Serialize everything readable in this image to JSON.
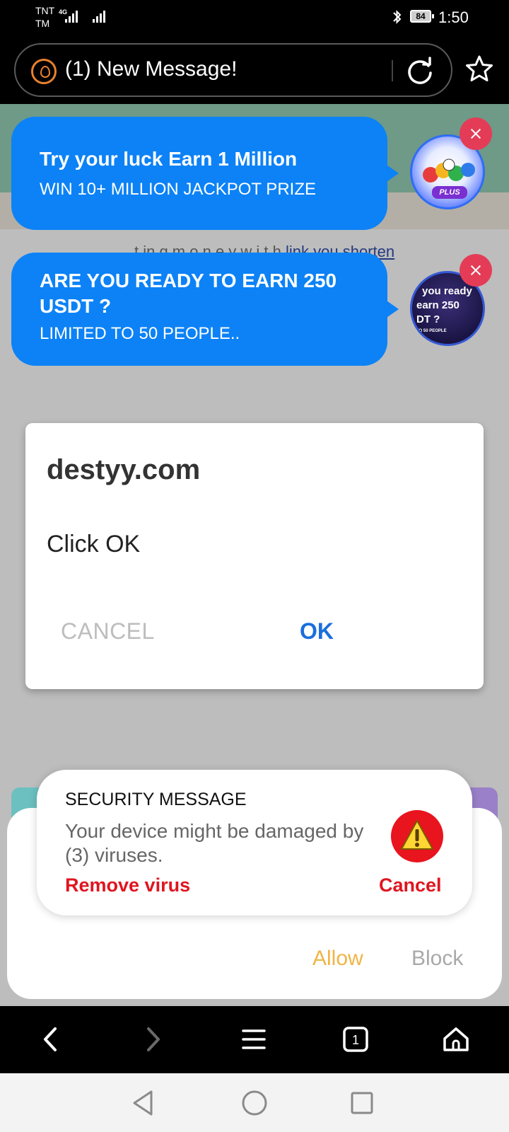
{
  "status_bar": {
    "carrier_line1": "TNT",
    "carrier_line2": "TM",
    "network_type": "4G",
    "battery_level": "84",
    "time": "1:50"
  },
  "address_bar": {
    "title": "(1) New Message!"
  },
  "page": {
    "text_fragment": "t in g  m  o  n  e  y  w  i  t  h",
    "link_text": "link you shorten"
  },
  "chat_heads": [
    {
      "title": "Try your luck Earn 1 Million",
      "subtitle": "WIN 10+ MILLION JACKPOT PRIZE",
      "avatar_label": "PLUS"
    },
    {
      "title": "ARE YOU READY TO EARN 250 USDT ?",
      "subtitle": "LIMITED TO 50 PEOPLE..",
      "avatar_line1": "you ready",
      "avatar_line2": "earn 250",
      "avatar_line3": "DT ?",
      "avatar_line4": "TO 50 PEOPLE"
    }
  ],
  "dialog": {
    "title": "destyy.com",
    "message": "Click OK",
    "cancel_label": "CANCEL",
    "ok_label": "OK"
  },
  "security_toast": {
    "title": "SECURITY MESSAGE",
    "body": "Your device might be damaged by (3) viruses.",
    "remove_label": "Remove virus",
    "cancel_label": "Cancel"
  },
  "permission": {
    "allow_label": "Allow",
    "block_label": "Block"
  },
  "browser_nav": {
    "tab_count": "1"
  },
  "colors": {
    "bubble_blue": "#0c82f6",
    "close_red": "#e43c57",
    "dialog_ok_blue": "#1a6fdc",
    "toast_red": "#e01520",
    "allow_amber": "#f0b446"
  }
}
